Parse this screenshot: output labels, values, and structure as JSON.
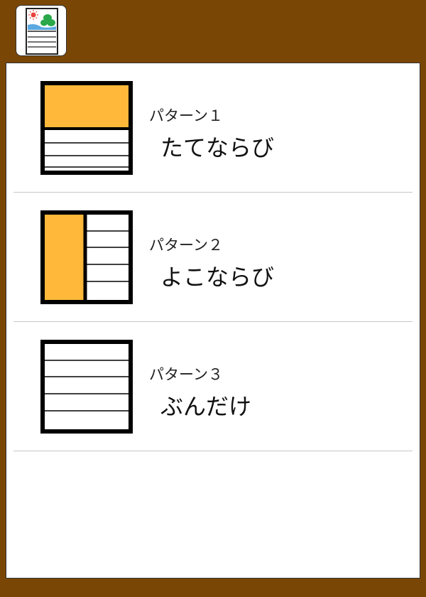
{
  "header": {
    "menu_icon": "karuta-card-icon",
    "icon_colors": {
      "sun": "#e8413a",
      "tree": "#2aa84a",
      "sea": "#5aa8e0"
    }
  },
  "colors": {
    "frame": "#7a4606",
    "highlight": "#ffb83a"
  },
  "patterns": [
    {
      "number": "パターン１",
      "name": "たてならび",
      "icon": "vertical-layout-icon"
    },
    {
      "number": "パターン２",
      "name": "よこならび",
      "icon": "horizontal-layout-icon"
    },
    {
      "number": "パターン３",
      "name": "ぶんだけ",
      "icon": "text-only-layout-icon"
    }
  ]
}
